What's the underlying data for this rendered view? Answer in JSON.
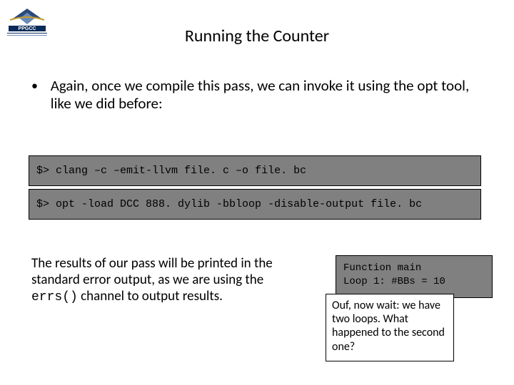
{
  "title": "Running the Counter",
  "bullet": "Again, once we compile this pass, we can invoke it using the opt tool, like we did before:",
  "code": {
    "line1_prompt": "$> ",
    "line1_body": "clang –c –emit-llvm file. c –o file. bc",
    "line2_prompt": "$> ",
    "line2_body": "opt -load DCC 888. dylib -bbloop -disable-output file. bc"
  },
  "bottom_text_pre": "The results of our pass will be printed in the standard error output, as we are using the ",
  "bottom_text_mono": "errs()",
  "bottom_text_post": " channel to output results.",
  "output": {
    "row1": "Function main",
    "row2": "Loop 1: #BBs = 10"
  },
  "note": "Ouf, now wait: we have two loops. What happened to the second one?",
  "logo_label": "PPGCC"
}
